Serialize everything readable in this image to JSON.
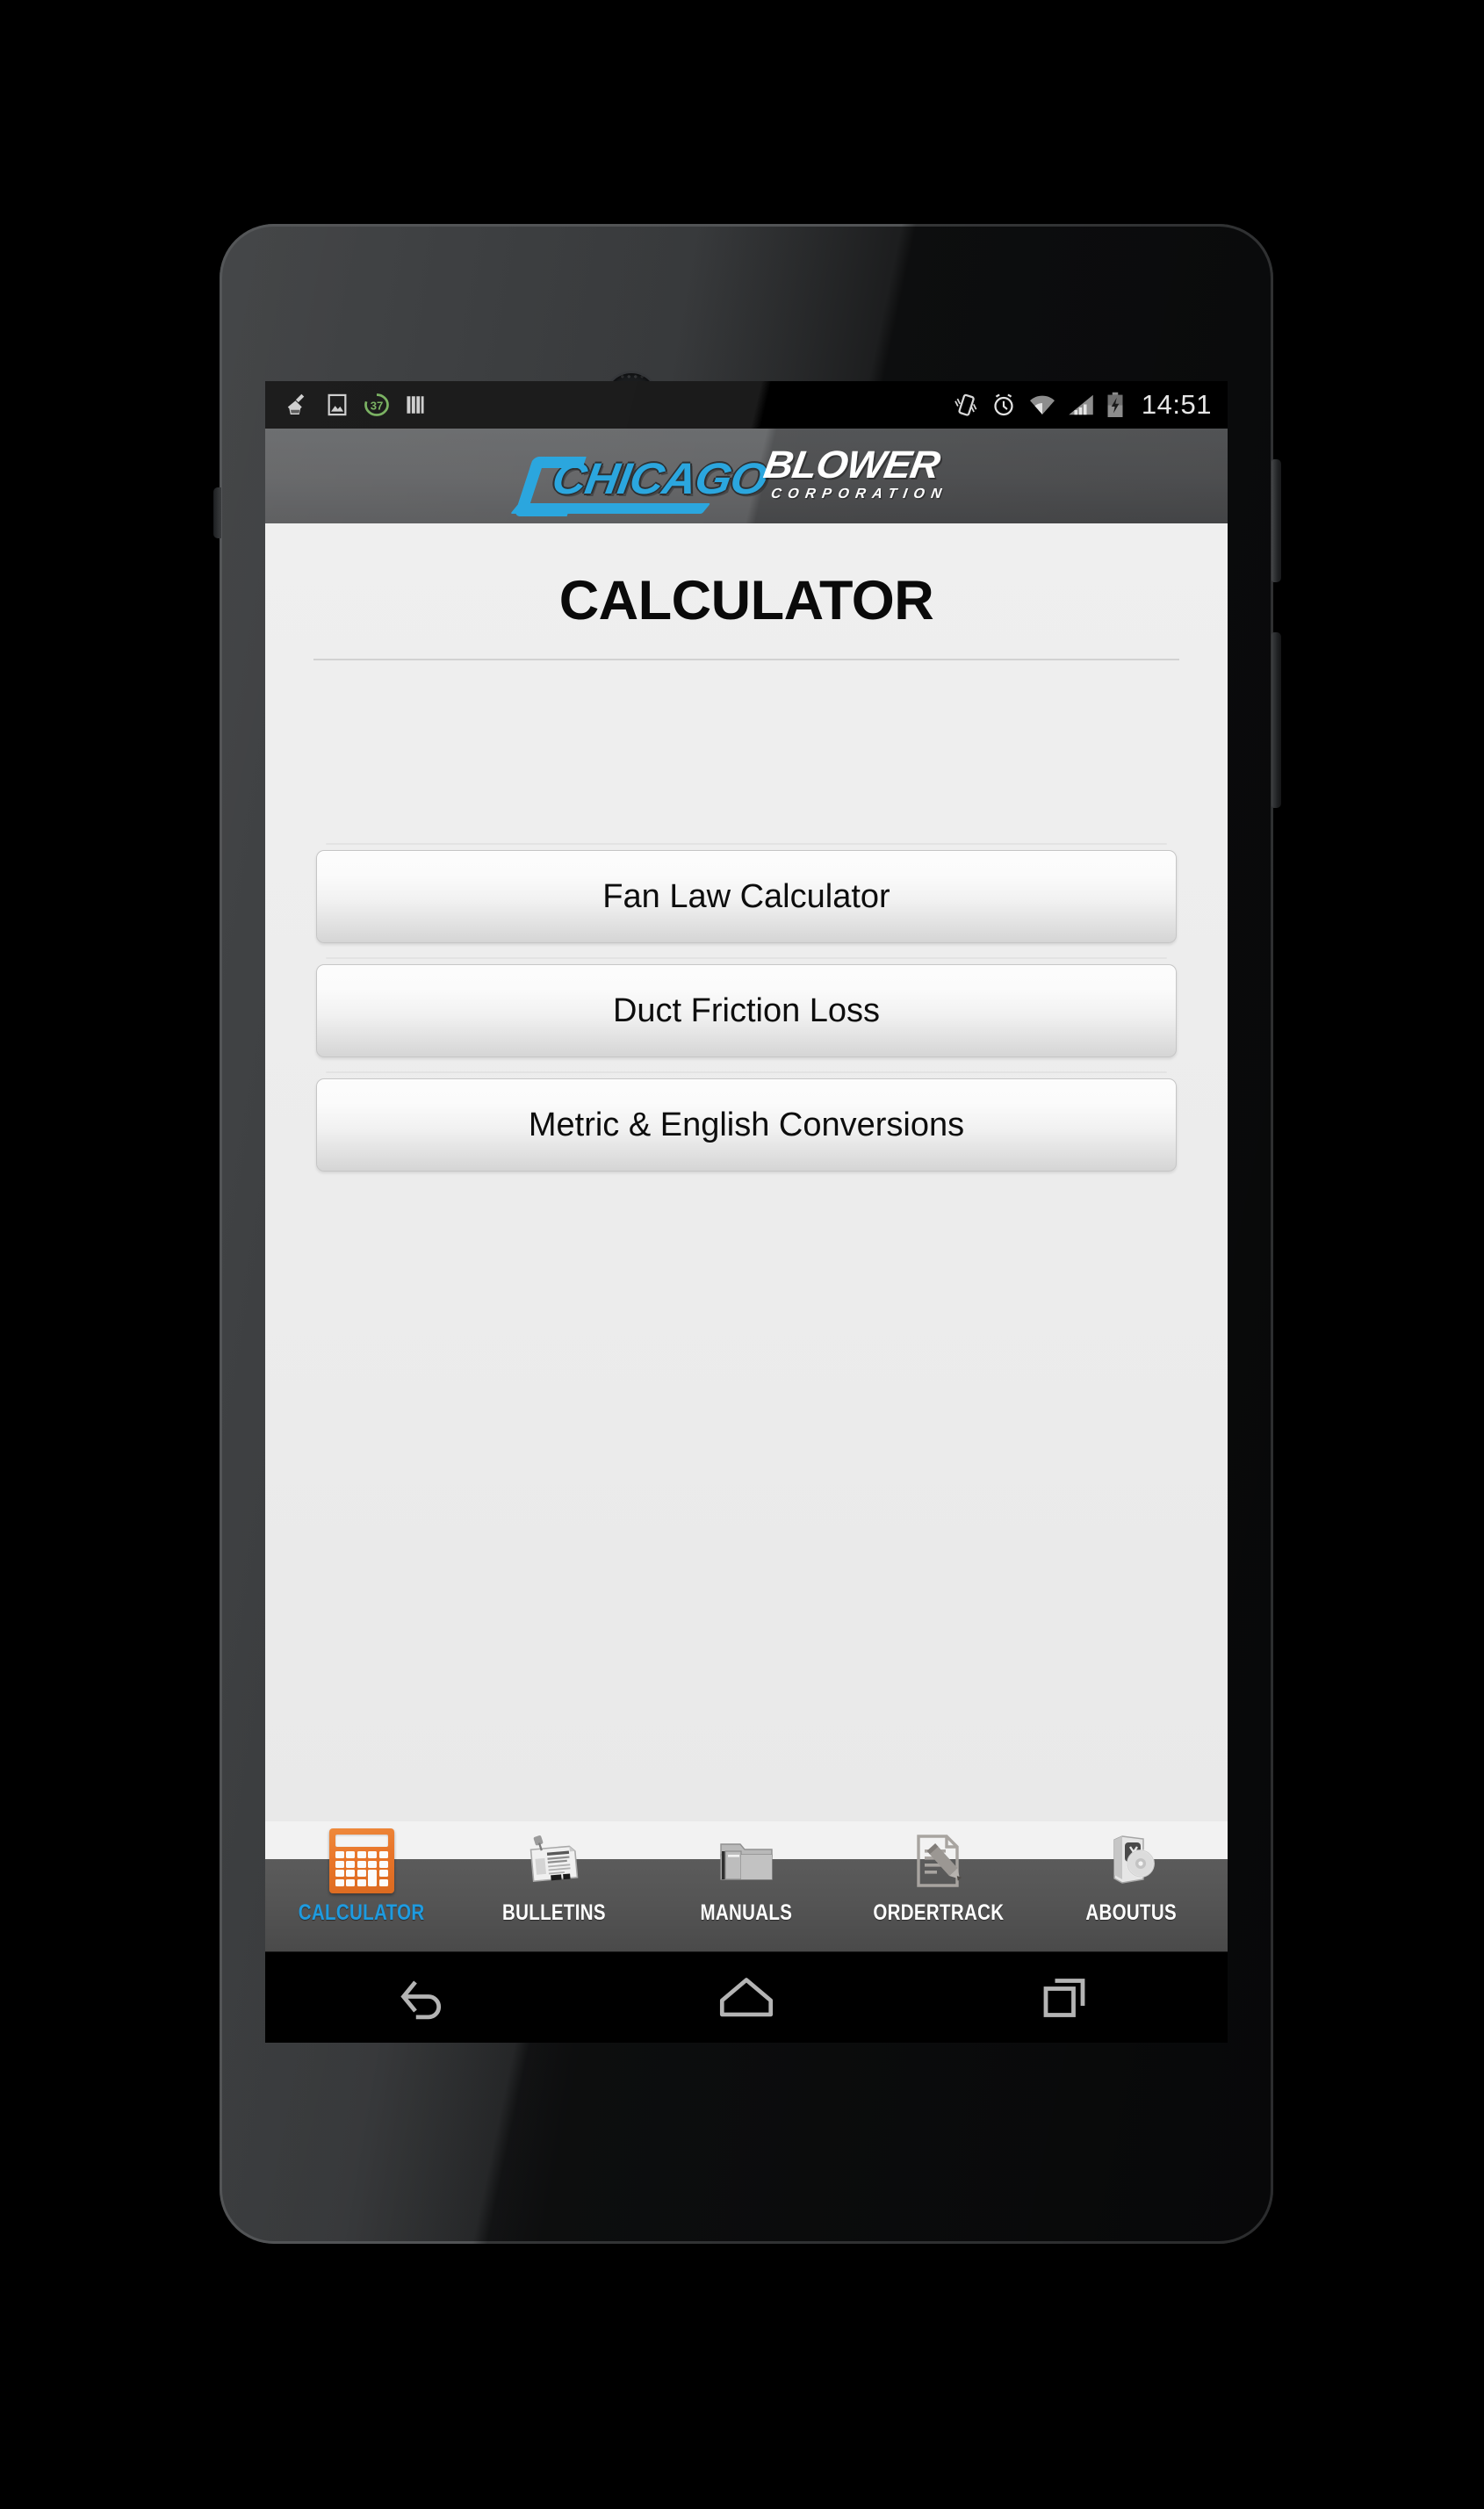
{
  "device": {
    "name": "android-phone"
  },
  "status_bar": {
    "clock": "14:51",
    "left_icons": [
      {
        "name": "cleaner-broom-icon"
      },
      {
        "name": "gallery-image-icon"
      },
      {
        "name": "battery-saver-icon",
        "value": "37"
      },
      {
        "name": "book-stack-icon"
      }
    ],
    "right_icons": [
      {
        "name": "vibrate-icon"
      },
      {
        "name": "alarm-clock-icon"
      },
      {
        "name": "wifi-icon"
      },
      {
        "name": "cellular-signal-icon"
      },
      {
        "name": "battery-charging-icon"
      }
    ]
  },
  "header": {
    "logo_primary": "CHICAGO",
    "logo_secondary": "BLOWER",
    "logo_tertiary": "CORPORATION",
    "brand_blue": "#2BA6DE",
    "bar_color": "#58595b"
  },
  "content": {
    "page_title": "CALCULATOR",
    "background": "#ececec",
    "buttons": [
      {
        "label": "Fan Law Calculator",
        "name": "fan-law-calculator-button"
      },
      {
        "label": "Duct Friction Loss",
        "name": "duct-friction-loss-button"
      },
      {
        "label": "Metric & English Conversions",
        "name": "metric-english-conversions-button"
      }
    ]
  },
  "tab_bar": {
    "active_color": "#1E9BE0",
    "inactive_color": "#ffffff",
    "tabs": [
      {
        "label": "CALCULATOR",
        "icon": "calculator-icon",
        "active": true
      },
      {
        "label": "BULLETINS",
        "icon": "newspaper-icon",
        "active": false
      },
      {
        "label": "MANUALS",
        "icon": "folder-icon",
        "active": false
      },
      {
        "label": "ORDERTRACK",
        "icon": "document-pencil-icon",
        "active": false
      },
      {
        "label": "ABOUTUS",
        "icon": "software-box-cd-icon",
        "active": false
      }
    ]
  },
  "nav_bar": {
    "buttons": [
      {
        "label": "Back",
        "icon": "back-arrow-icon"
      },
      {
        "label": "Home",
        "icon": "home-icon"
      },
      {
        "label": "Recents",
        "icon": "recents-icon"
      }
    ]
  }
}
